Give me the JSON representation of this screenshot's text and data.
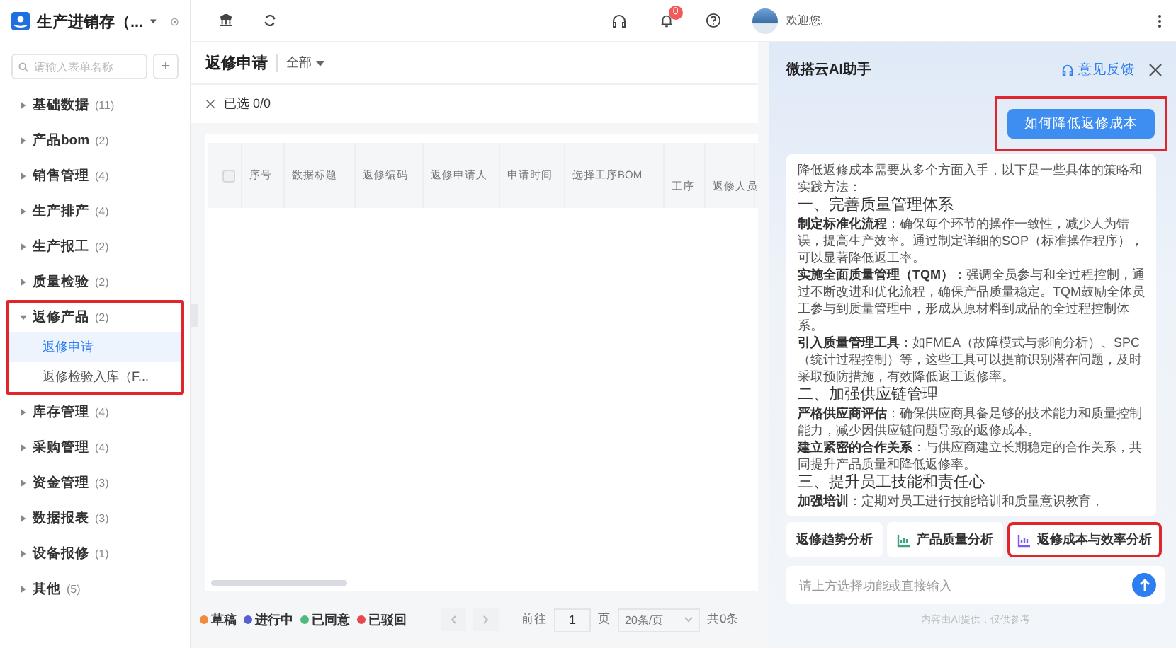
{
  "app": {
    "title": "生产进销存（..."
  },
  "sidebar": {
    "search": {
      "placeholder": "请输入表单名称"
    },
    "add_button": "+",
    "items": [
      {
        "label": "基础数据",
        "count": "(11)",
        "expanded": false,
        "highlighted": false
      },
      {
        "label": "产品bom",
        "count": "(2)",
        "expanded": false,
        "highlighted": false
      },
      {
        "label": "销售管理",
        "count": "(4)",
        "expanded": false,
        "highlighted": false
      },
      {
        "label": "生产排产",
        "count": "(4)",
        "expanded": false,
        "highlighted": false
      },
      {
        "label": "生产报工",
        "count": "(2)",
        "expanded": false,
        "highlighted": false
      },
      {
        "label": "质量检验",
        "count": "(2)",
        "expanded": false,
        "highlighted": false
      },
      {
        "label": "返修产品",
        "count": "(2)",
        "expanded": true,
        "highlighted": true,
        "children": [
          {
            "label": "返修申请",
            "selected": true
          },
          {
            "label": "返修检验入库（F...",
            "selected": false
          }
        ]
      },
      {
        "label": "库存管理",
        "count": "(4)",
        "expanded": false,
        "highlighted": false
      },
      {
        "label": "采购管理",
        "count": "(4)",
        "expanded": false,
        "highlighted": false
      },
      {
        "label": "资金管理",
        "count": "(3)",
        "expanded": false,
        "highlighted": false
      },
      {
        "label": "数据报表",
        "count": "(3)",
        "expanded": false,
        "highlighted": false
      },
      {
        "label": "设备报修",
        "count": "(1)",
        "expanded": false,
        "highlighted": false
      },
      {
        "label": "其他",
        "count": "(5)",
        "expanded": false,
        "highlighted": false
      }
    ]
  },
  "header": {
    "notification_badge": "0",
    "greeting": "欢迎您,"
  },
  "page": {
    "title": "返修申请",
    "filter": "全部",
    "selection": "已选 0/0",
    "table": {
      "select_all_checked": false,
      "columns": [
        "序号",
        "数据标题",
        "返修编码",
        "返修申请人",
        "申请时间",
        "选择工序BOM",
        "工序",
        "返修人员"
      ]
    },
    "legend": [
      {
        "label": "草稿",
        "color": "#f08a3c"
      },
      {
        "label": "进行中",
        "color": "#5a5fd0"
      },
      {
        "label": "已同意",
        "color": "#4fb87c"
      },
      {
        "label": "已驳回",
        "color": "#e5484d"
      }
    ],
    "pagination": {
      "goto_label": "前往",
      "page": "1",
      "page_unit": "页",
      "page_size": "20条/页",
      "total": "共0条"
    }
  },
  "assistant": {
    "title": "微搭云AI助手",
    "feedback": "意见反馈",
    "question": {
      "text": "如何降低返修成本",
      "highlighted": true
    },
    "answer": [
      {
        "kind": "para",
        "text": "降低返修成本需要从多个方面入手，以下是一些具体的策略和实践方法："
      },
      {
        "kind": "heading",
        "text": "一、完善质量管理体系"
      },
      {
        "kind": "para",
        "text": "**制定标准化流程**：确保每个环节的操作一致性，减少人为错误，提高生产效率。通过制定详细的SOP（标准操作程序），可以显著降低返工率。"
      },
      {
        "kind": "para",
        "text": "**实施全面质量管理（TQM）**：强调全员参与和全过程控制，通过不断改进和优化流程，确保产品质量稳定。TQM鼓励全体员工参与到质量管理中，形成从原材料到成品的全过程控制体系。"
      },
      {
        "kind": "para",
        "text": "**引入质量管理工具**：如FMEA（故障模式与影响分析）、SPC（统计过程控制）等，这些工具可以提前识别潜在问题，及时采取预防措施，有效降低返工返修率。"
      },
      {
        "kind": "heading",
        "text": "二、加强供应链管理"
      },
      {
        "kind": "para",
        "text": "**严格供应商评估**：确保供应商具备足够的技术能力和质量控制能力，减少因供应链问题导致的返修成本。"
      },
      {
        "kind": "para",
        "text": "**建立紧密的合作关系**：与供应商建立长期稳定的合作关系，共同提升产品质量和降低返修率。"
      },
      {
        "kind": "heading",
        "text": "三、提升员工技能和责任心"
      },
      {
        "kind": "para",
        "text": "**加强培训**：定期对员工进行技能培训和质量意识教育，"
      }
    ],
    "chips": [
      {
        "label": "返修趋势分析",
        "icon": false,
        "highlighted": false
      },
      {
        "label": "产品质量分析",
        "icon": true,
        "highlighted": false
      },
      {
        "label": "返修成本与效率分析",
        "icon": true,
        "highlighted": true
      }
    ],
    "input": {
      "placeholder": "请上方选择功能或直接输入"
    },
    "disclaimer": "内容由AI提供，仅供参考"
  }
}
